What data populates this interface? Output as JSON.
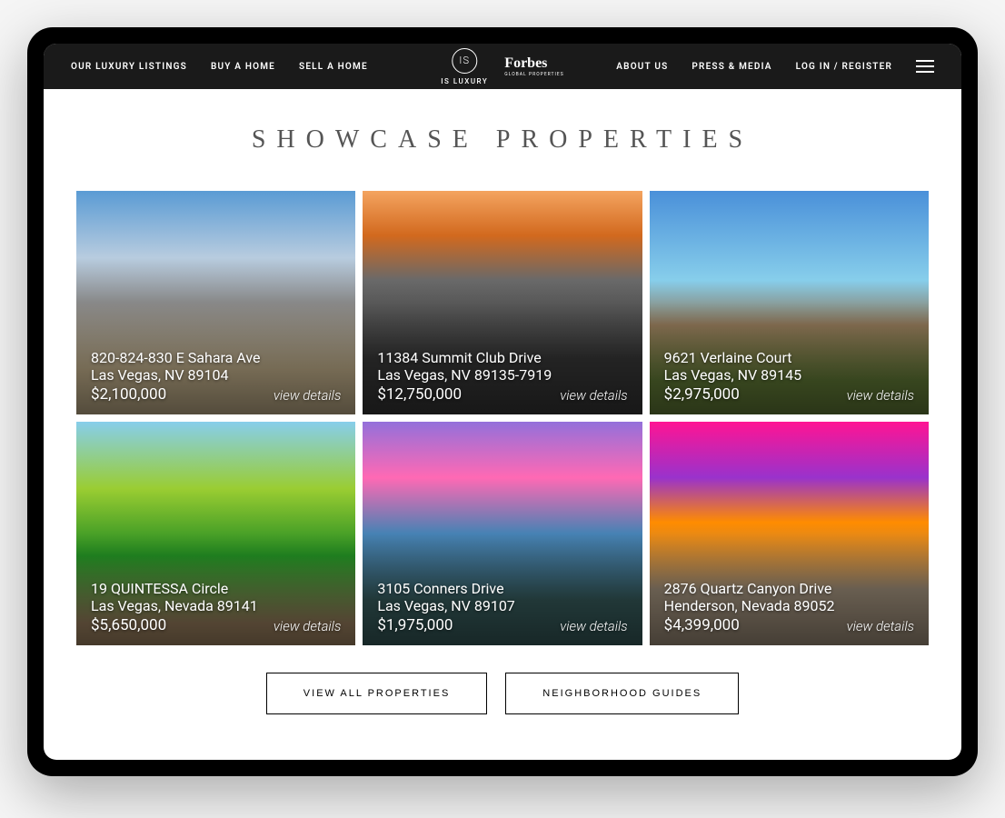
{
  "nav": {
    "left": [
      {
        "label": "OUR LUXURY LISTINGS"
      },
      {
        "label": "BUY A HOME"
      },
      {
        "label": "SELL A HOME"
      }
    ],
    "right": [
      {
        "label": "ABOUT US"
      },
      {
        "label": "PRESS & MEDIA"
      },
      {
        "label": "LOG IN / REGISTER"
      }
    ]
  },
  "logo": {
    "brand_name": "IS LUXURY",
    "partner_name": "Forbes",
    "partner_sub": "GLOBAL PROPERTIES"
  },
  "section_title": "SHOWCASE PROPERTIES",
  "view_details_label": "view details",
  "properties": [
    {
      "address": "820-824-830 E Sahara Ave",
      "city": "Las Vegas, NV 89104",
      "price": "$2,100,000"
    },
    {
      "address": "11384 Summit Club Drive",
      "city": "Las Vegas, NV 89135-7919",
      "price": "$12,750,000"
    },
    {
      "address": "9621 Verlaine Court",
      "city": "Las Vegas, NV 89145",
      "price": "$2,975,000"
    },
    {
      "address": "19 QUINTESSA Circle",
      "city": "Las Vegas, Nevada 89141",
      "price": "$5,650,000"
    },
    {
      "address": "3105 Conners Drive",
      "city": "Las Vegas, NV 89107",
      "price": "$1,975,000"
    },
    {
      "address": "2876 Quartz Canyon Drive",
      "city": "Henderson, Nevada 89052",
      "price": "$4,399,000"
    }
  ],
  "buttons": {
    "view_all": "VIEW ALL PROPERTIES",
    "guides": "NEIGHBORHOOD GUIDES"
  }
}
